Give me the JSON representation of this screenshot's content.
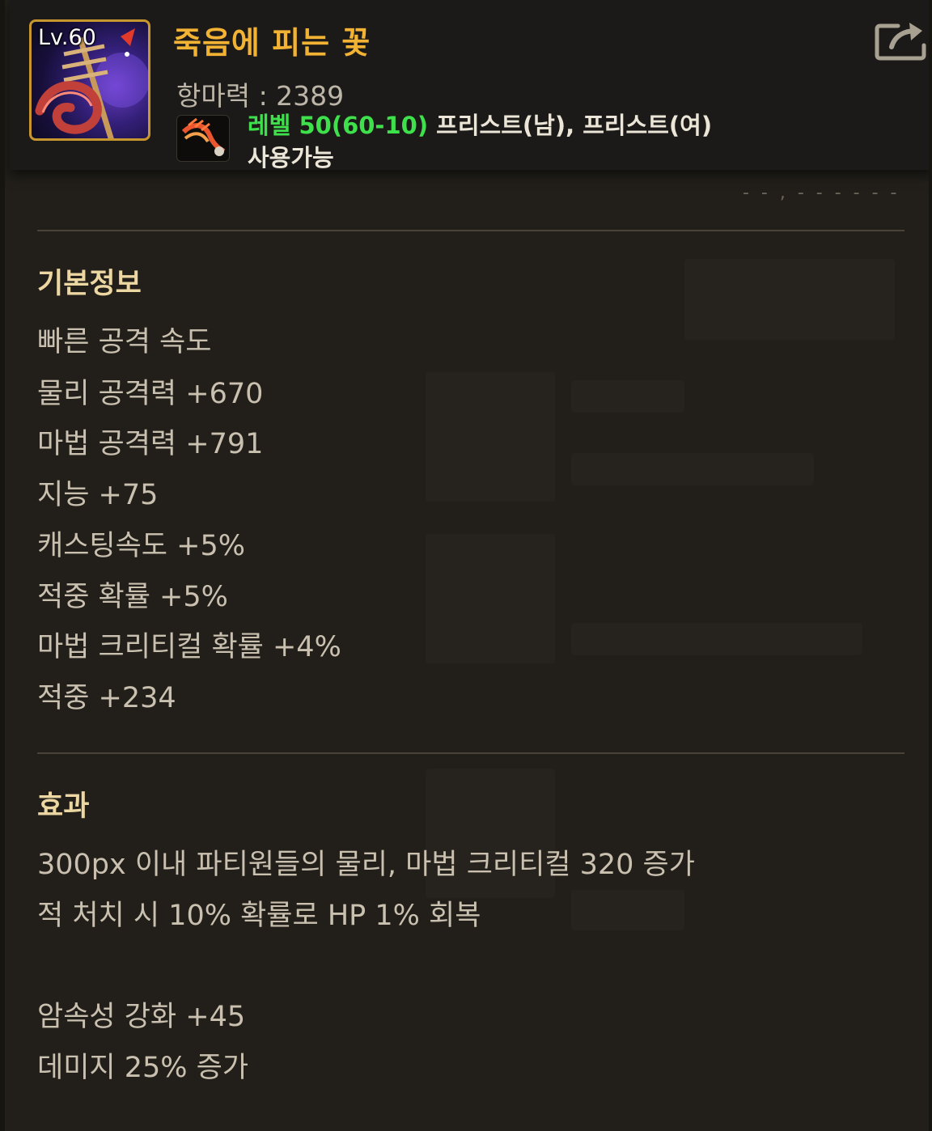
{
  "item": {
    "level_badge": "Lv.60",
    "name": "죽음에 피는 꽃",
    "anti_magic": "항마력 : 2389",
    "requirement_level": "레벨 50(60-10)",
    "requirement_classes": " 프리스트(남), 프리스트(여)",
    "usable": "사용가능",
    "icon": "scythe-item-icon",
    "class_icon": "priest-class-icon",
    "name_color": "#f2b233",
    "requirement_color": "#3ee04c"
  },
  "header": {
    "share_icon": "share-icon",
    "cut_off_text": "- - , - - -  - - -"
  },
  "basic_info": {
    "title": "기본정보",
    "stats": [
      "빠른 공격 속도",
      "물리 공격력 +670",
      "마법 공격력 +791",
      "지능 +75",
      "캐스팅속도 +5%",
      "적중 확률 +5%",
      "마법 크리티컬 확률 +4%",
      "적중 +234"
    ]
  },
  "effects": {
    "title": "효과",
    "lines": [
      "300px 이내 파티원들의 물리, 마법 크리티컬 320 증가",
      "적 처치 시 10% 확률로 HP 1% 회복",
      "암속성 강화 +45",
      "데미지 25% 증가"
    ]
  }
}
